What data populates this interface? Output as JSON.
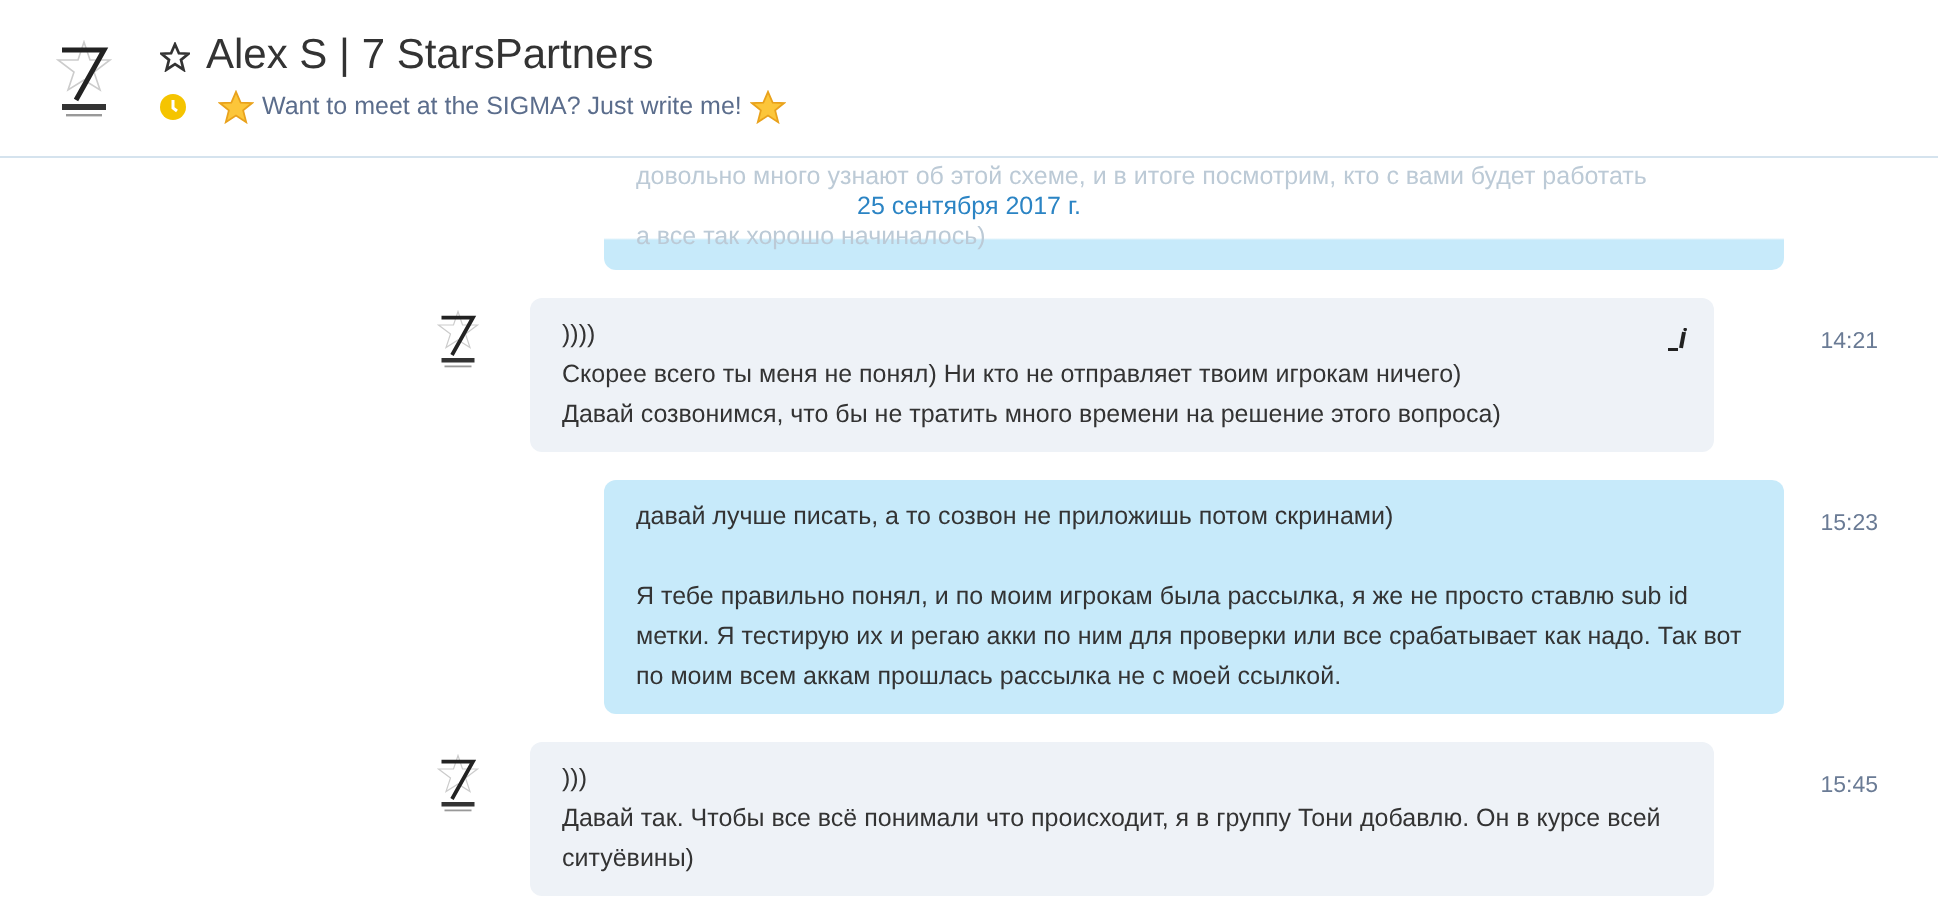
{
  "header": {
    "title": "Alex S | 7 StarsPartners",
    "favorite": false,
    "mood": "Want to meet at the SIGMA? Just write me!"
  },
  "date_divider": "25 сентября 2017 г.",
  "messages": [
    {
      "kind": "outgoing",
      "faded": true,
      "paragraphs": [
        [
          "довольно много узнают об этой схеме, и в итоге посмотрим, кто с вами будет работать",
          "а все так хорошо начиналось)"
        ]
      ]
    },
    {
      "kind": "incoming",
      "faded": false,
      "time": "14:21",
      "edited": true,
      "paragraphs": [
        [
          "))))",
          "Скорее всего ты меня не понял) Ни кто не отправляет твоим игрокам ничего)",
          "Давай созвонимся, что бы не тратить много времени на решение этого вопроса)"
        ]
      ]
    },
    {
      "kind": "outgoing",
      "faded": false,
      "time": "15:23",
      "edited": false,
      "paragraphs": [
        [
          "давай лучше писать, а то созвон не приложишь потом скринами)"
        ],
        [
          "Я тебе правильно понял, и по моим игрокам была рассылка, я же не просто ставлю sub id метки. Я тестирую их и регаю акки по ним для проверки или все срабатывает как надо. Так вот по моим всем аккам прошлась рассылка не с моей ссылкой."
        ]
      ]
    },
    {
      "kind": "incoming",
      "faded": false,
      "time": "15:45",
      "edited": false,
      "paragraphs": [
        [
          ")))",
          "Давай так. Чтобы все всё понимали что происходит, я в группу Тони добавлю. Он в курсе всей ситуёвины)"
        ]
      ]
    }
  ]
}
